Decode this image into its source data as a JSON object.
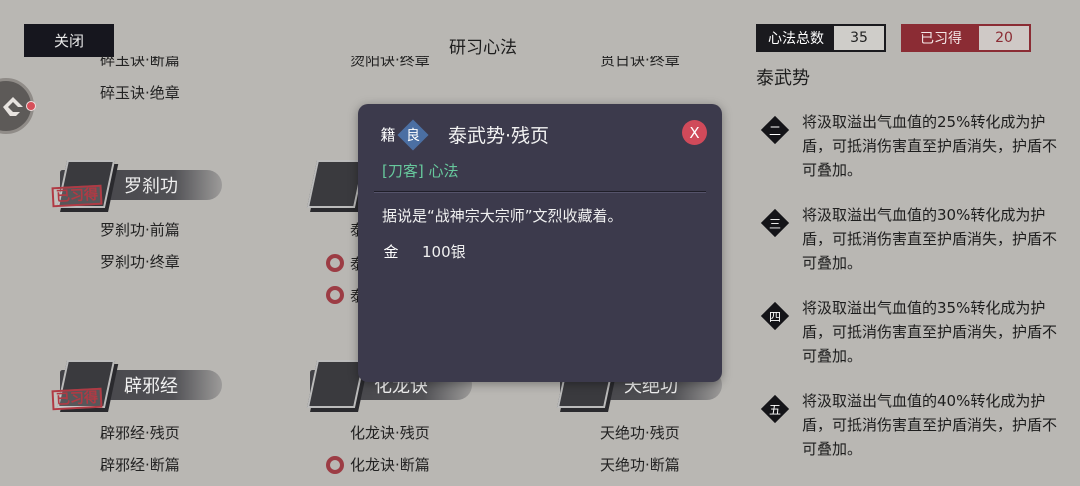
{
  "header": {
    "close_label": "关闭",
    "title": "研习心法",
    "total_label": "心法总数",
    "total_value": "35",
    "learned_label": "已习得",
    "learned_value": "20"
  },
  "grid": {
    "col1_top_partial": "碎玉诀·断篇",
    "col1_top": "碎玉诀·绝章",
    "col2_top_partial": "烫阳诀·终章",
    "col3_top_partial": "贯日诀·终章",
    "group_luosha": {
      "name": "罗刹功",
      "stamp": "已习得",
      "items": [
        "罗刹功·前篇",
        "罗刹功·终章"
      ]
    },
    "group_mid_partial": {
      "items": [
        "泰",
        "泰",
        "泰"
      ]
    },
    "group_pixie": {
      "name": "辟邪经",
      "stamp": "已习得",
      "items": [
        "辟邪经·残页",
        "辟邪经·断篇"
      ]
    },
    "group_hualong": {
      "name": "化龙诀",
      "items": [
        "化龙诀·残页",
        "化龙诀·断篇"
      ]
    },
    "group_tianjue": {
      "name": "天绝功",
      "items": [
        "天绝功·残页",
        "天绝功·断篇"
      ]
    }
  },
  "modal": {
    "badge_type": "籍",
    "badge_grade": "良",
    "title": "泰武势·残页",
    "close": "X",
    "category": "[刀客] 心法",
    "description": "据说是“战神宗大宗师”文烈收藏着。",
    "coin_label": "金",
    "price": "100银"
  },
  "right_panel": {
    "title": "泰武势",
    "effects": [
      {
        "tier": "二",
        "text": "将汲取溢出气血值的25%转化成为护盾，可抵消伤害直至护盾消失，护盾不可叠加。"
      },
      {
        "tier": "三",
        "text": "将汲取溢出气血值的30%转化成为护盾，可抵消伤害直至护盾消失，护盾不可叠加。"
      },
      {
        "tier": "四",
        "text": "将汲取溢出气血值的35%转化成为护盾，可抵消伤害直至护盾消失，护盾不可叠加。"
      },
      {
        "tier": "五",
        "text": "将汲取溢出气血值的40%转化成为护盾，可抵消伤害直至护盾消失，护盾不可叠加。"
      }
    ]
  }
}
